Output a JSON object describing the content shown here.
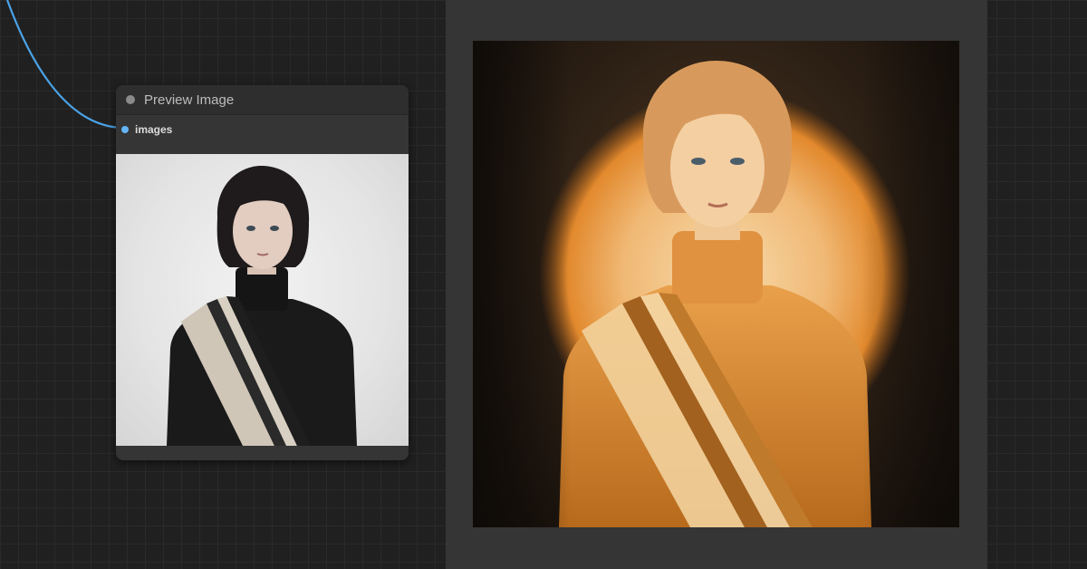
{
  "node": {
    "title": "Preview Image",
    "input_label": "images"
  },
  "colors": {
    "link": "#4aa3e8",
    "slot": "#64b5f6",
    "canvas_bg": "#202020",
    "node_bg": "#353535",
    "panel_bg": "#353535"
  },
  "icons": {
    "status": "node-status-dot",
    "slot": "input-slot-dot"
  }
}
